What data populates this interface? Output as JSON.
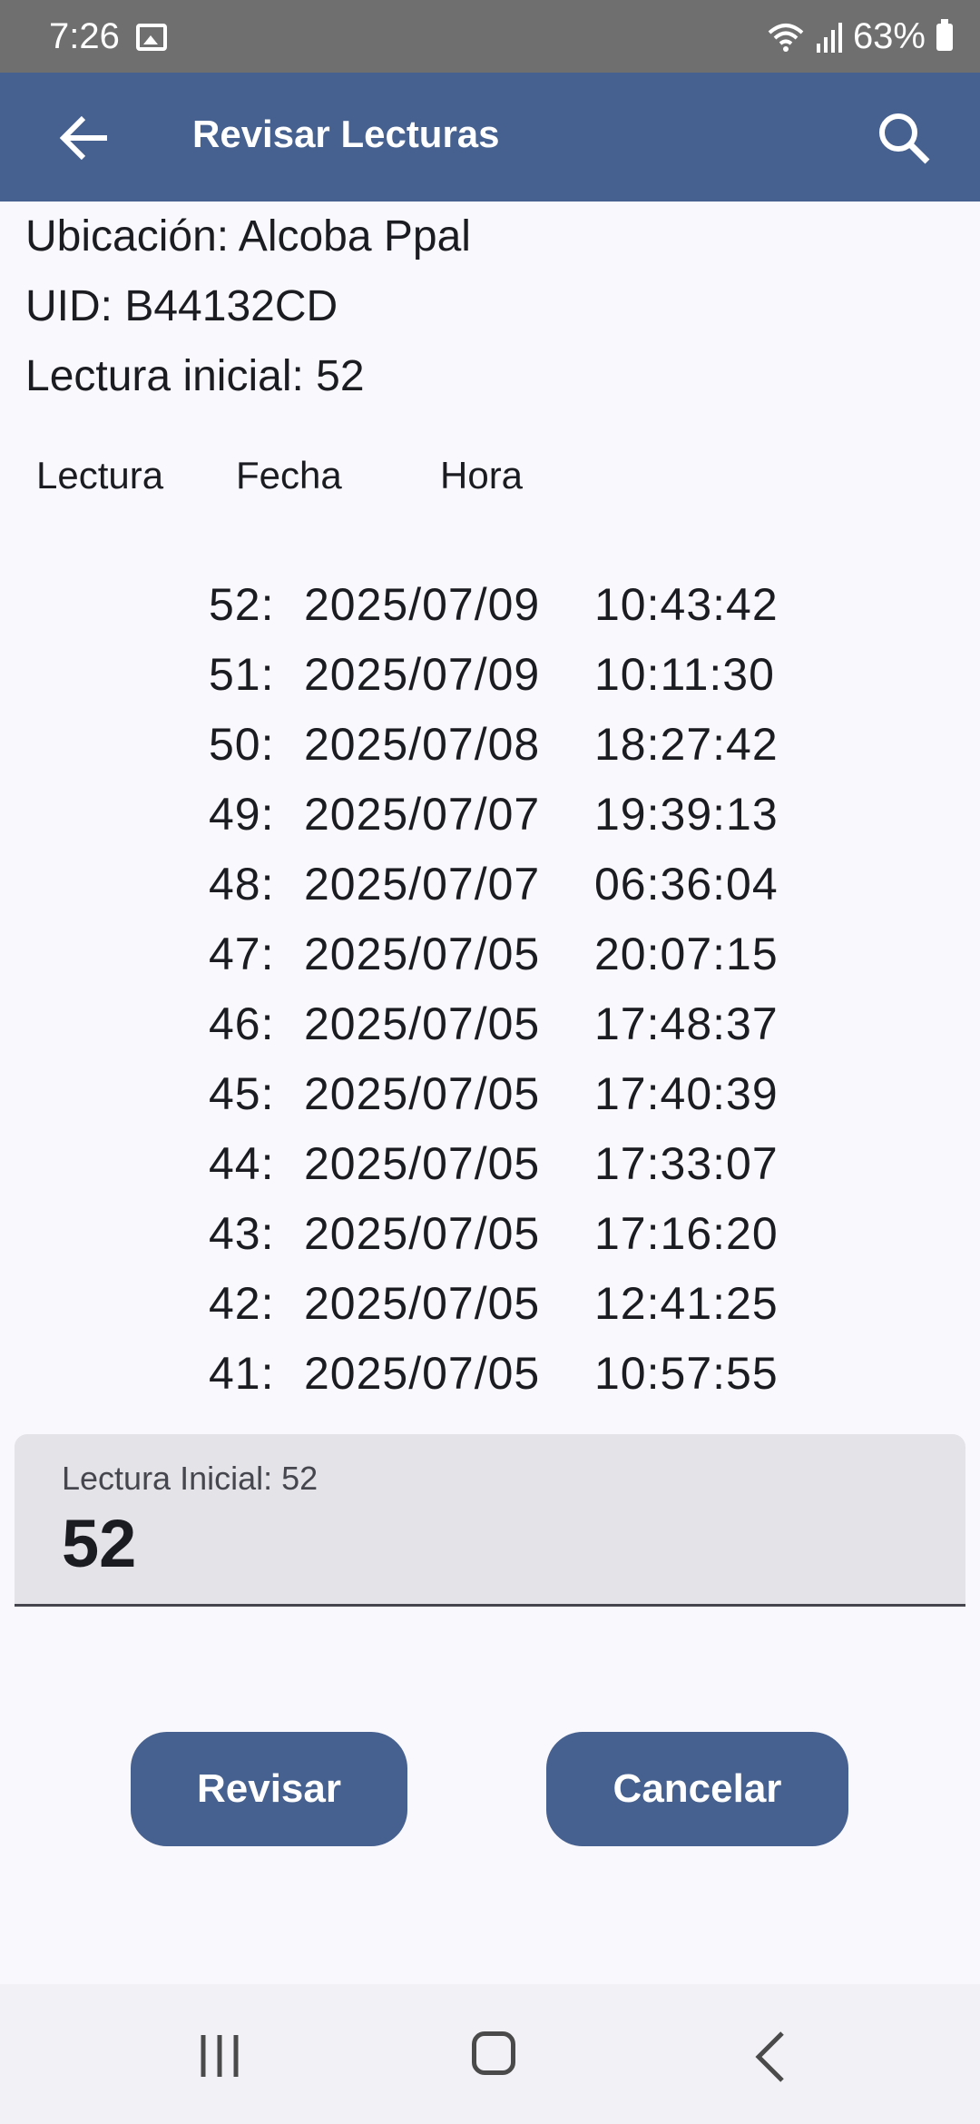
{
  "status_bar": {
    "time": "7:26",
    "battery": "63%"
  },
  "app_bar": {
    "title": "Revisar Lecturas"
  },
  "info": {
    "ubicacion": "Ubicación: Alcoba Ppal",
    "uid": "UID: B44132CD",
    "lectura_inicial": "Lectura inicial: 52"
  },
  "columns": {
    "lectura": "Lectura",
    "fecha": "Fecha",
    "hora": "Hora"
  },
  "readings": [
    {
      "num": "52:",
      "date": "2025/07/09",
      "time": "10:43:42"
    },
    {
      "num": "51:",
      "date": "2025/07/09",
      "time": "10:11:30"
    },
    {
      "num": "50:",
      "date": "2025/07/08",
      "time": "18:27:42"
    },
    {
      "num": "49:",
      "date": "2025/07/07",
      "time": "19:39:13"
    },
    {
      "num": "48:",
      "date": "2025/07/07",
      "time": "06:36:04"
    },
    {
      "num": "47:",
      "date": "2025/07/05",
      "time": "20:07:15"
    },
    {
      "num": "46:",
      "date": "2025/07/05",
      "time": "17:48:37"
    },
    {
      "num": "45:",
      "date": "2025/07/05",
      "time": "17:40:39"
    },
    {
      "num": "44:",
      "date": "2025/07/05",
      "time": "17:33:07"
    },
    {
      "num": "43:",
      "date": "2025/07/05",
      "time": "17:16:20"
    },
    {
      "num": "42:",
      "date": "2025/07/05",
      "time": "12:41:25"
    },
    {
      "num": "41:",
      "date": "2025/07/05",
      "time": "10:57:55"
    }
  ],
  "input": {
    "label": "Lectura Inicial: 52",
    "value": "52"
  },
  "buttons": {
    "revisar": "Revisar",
    "cancelar": "Cancelar"
  }
}
